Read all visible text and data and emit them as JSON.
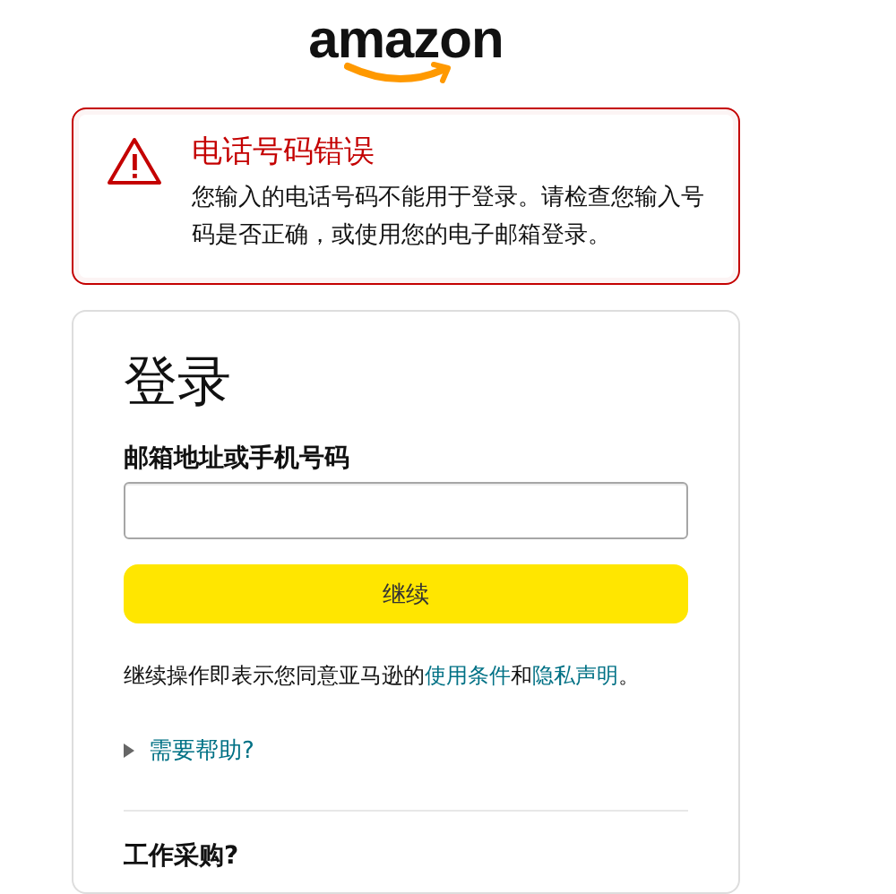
{
  "logo": {
    "text": "amazon"
  },
  "alert": {
    "title": "电话号码错误",
    "message": "您输入的电话号码不能用于登录。请检查您输入号码是否正确，或使用您的电子邮箱登录。"
  },
  "signin": {
    "heading": "登录",
    "field_label": "邮箱地址或手机号码",
    "button": "继续",
    "terms": {
      "before": "继续操作即表示您同意亚马逊的",
      "link_1": "使用条件",
      "middle": "和",
      "link_2": "隐私声明",
      "after": "。"
    },
    "help": {
      "label": "需要帮助?",
      "expanded": false
    },
    "business_heading": "工作采购?"
  }
}
